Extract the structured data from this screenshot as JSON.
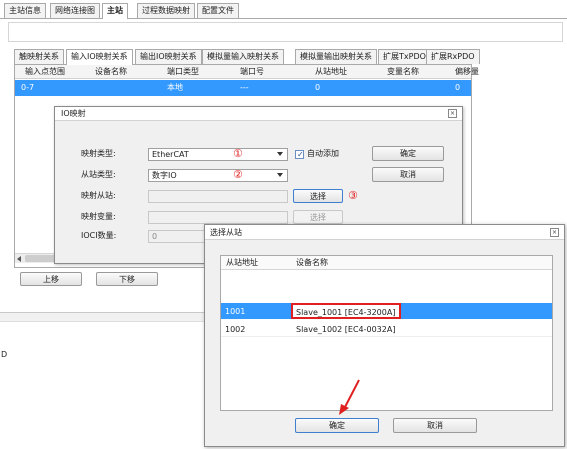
{
  "top_tabs": [
    "主站信息",
    "网络连接图",
    "主站",
    "过程数据映射",
    "配置文件"
  ],
  "sub_tabs": [
    "触映射关系",
    "输入IO映射关系",
    "输出IO映射关系",
    "模拟量输入映射关系",
    "模拟量输出映射关系",
    "扩展TxPDO",
    "扩展RxPDO"
  ],
  "main_table": {
    "headers": [
      "输入点范围",
      "设备名称",
      "端口类型",
      "端口号",
      "从站地址",
      "变量名称",
      "偏移量"
    ],
    "row": [
      "0-7",
      "",
      "本地",
      "---",
      "0",
      "",
      "0"
    ]
  },
  "buttons": {
    "move_up": "上移",
    "move_down": "下移"
  },
  "io_dialog": {
    "title": "IO映射",
    "map_type_label": "映射类型:",
    "map_type_value": "EtherCAT",
    "slave_type_label": "从站类型:",
    "slave_type_value": "数字IO",
    "map_slave_label": "映射从站:",
    "map_var_label": "映射变量:",
    "ioc_count_label": "IOCI数量:",
    "ioc_count_value": "0",
    "auto_add_label": "自动添加",
    "auto_add_checked": true,
    "confirm": "确定",
    "cancel": "取消",
    "select": "选择",
    "select2": "选择",
    "marker1": "①",
    "marker2": "②",
    "marker3": "③"
  },
  "select_dialog": {
    "title": "选择从站",
    "headers": [
      "从站地址",
      "设备名称"
    ],
    "rows": [
      {
        "addr": "1001",
        "name": "Slave_1001 [EC4-3200A]",
        "selected": true
      },
      {
        "addr": "1002",
        "name": "Slave_1002 [EC4-0032A]",
        "selected": false
      }
    ],
    "confirm": "确定",
    "cancel": "取消"
  },
  "lower_panel_text": "D",
  "colors": {
    "selection": "#3399ff",
    "highlight_box": "#e02020",
    "accent_red": "#e02020"
  }
}
